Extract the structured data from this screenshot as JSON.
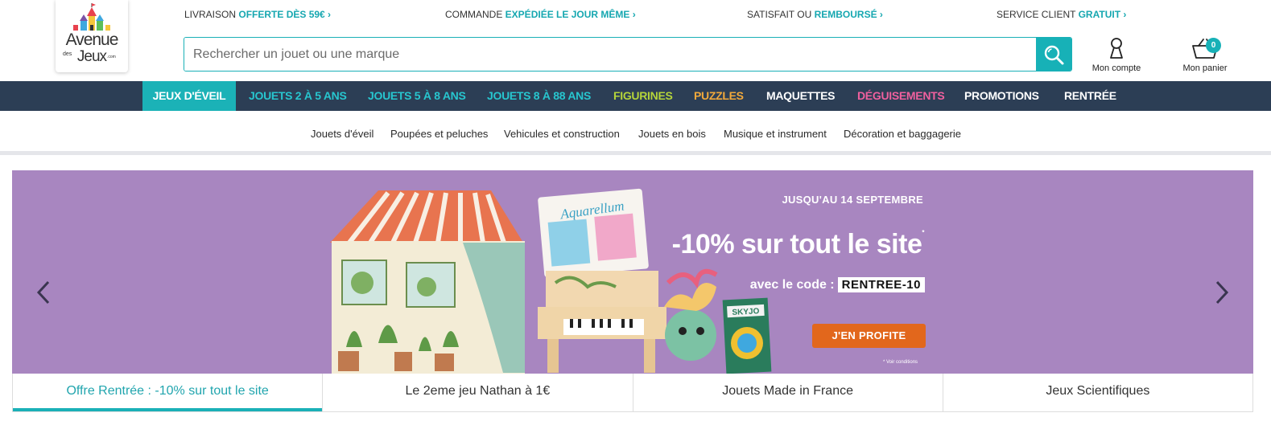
{
  "logo": {
    "line1": "Avenue",
    "pre": "des",
    "line2": "Jeux",
    "suffix": ".com"
  },
  "usps": [
    {
      "text": "LIVRAISON ",
      "highlight": "OFFERTE DÈS 59€ ›"
    },
    {
      "text": "COMMANDE ",
      "highlight": "EXPÉDIÉE LE JOUR MÊME ›"
    },
    {
      "text": "SATISFAIT OU ",
      "highlight": "REMBOURSÉ ›"
    },
    {
      "text": "SERVICE CLIENT ",
      "highlight": "GRATUIT ›"
    }
  ],
  "search": {
    "placeholder": "Rechercher un jouet ou une marque"
  },
  "account": {
    "label": "Mon compte",
    "icon": "user-icon"
  },
  "cart": {
    "label": "Mon panier",
    "count": "0",
    "icon": "basket-icon"
  },
  "main_nav": {
    "items": [
      {
        "label": "JEUX D'ÉVEIL",
        "color": "#ffffff"
      },
      {
        "label": "JOUETS 2 À 5 ANS",
        "color": "#27c6cf"
      },
      {
        "label": "JOUETS 5 À 8 ANS",
        "color": "#27c6cf"
      },
      {
        "label": "JOUETS 8 À 88 ANS",
        "color": "#27c6cf"
      },
      {
        "label": "FIGURINES",
        "color": "#b5d43a"
      },
      {
        "label": "PUZZLES",
        "color": "#f2a93b"
      },
      {
        "label": "MAQUETTES",
        "color": "#ffffff"
      },
      {
        "label": "DÉGUISEMENTS",
        "color": "#f0609e"
      },
      {
        "label": "PROMOTIONS",
        "color": "#ffffff"
      },
      {
        "label": "RENTRÉE",
        "color": "#ffffff"
      }
    ],
    "bg": "#2c3e55",
    "active_bg": "#1bb2b7"
  },
  "sub_nav": {
    "items": [
      "Jouets d'éveil",
      "Poupées et peluches",
      "Vehicules et construction",
      "Jouets en bois",
      "Musique et instrument",
      "Décoration et baggagerie"
    ]
  },
  "hero": {
    "bg_color": "#a886c0",
    "date": "JUSQU'AU 14 SEPTEMBRE",
    "title": "-10% sur tout le site",
    "title_mark": "*",
    "code_prefix": "avec le code :",
    "code": "RENTREE-10",
    "cta": "J'EN PROFITE",
    "conditions": "* Voir conditions",
    "product_labels": {
      "box1": "Aquarellum",
      "box2": "SKYJO"
    }
  },
  "tabs": [
    {
      "label": "Offre Rentrée : -10% sur tout le site",
      "active": true
    },
    {
      "label": "Le 2eme jeu Nathan à 1€",
      "active": false
    },
    {
      "label": "Jouets Made in France",
      "active": false
    },
    {
      "label": "Jeux Scientifiques",
      "active": false
    }
  ],
  "colors": {
    "accent": "#17b1b7",
    "cta": "#e2671c"
  }
}
